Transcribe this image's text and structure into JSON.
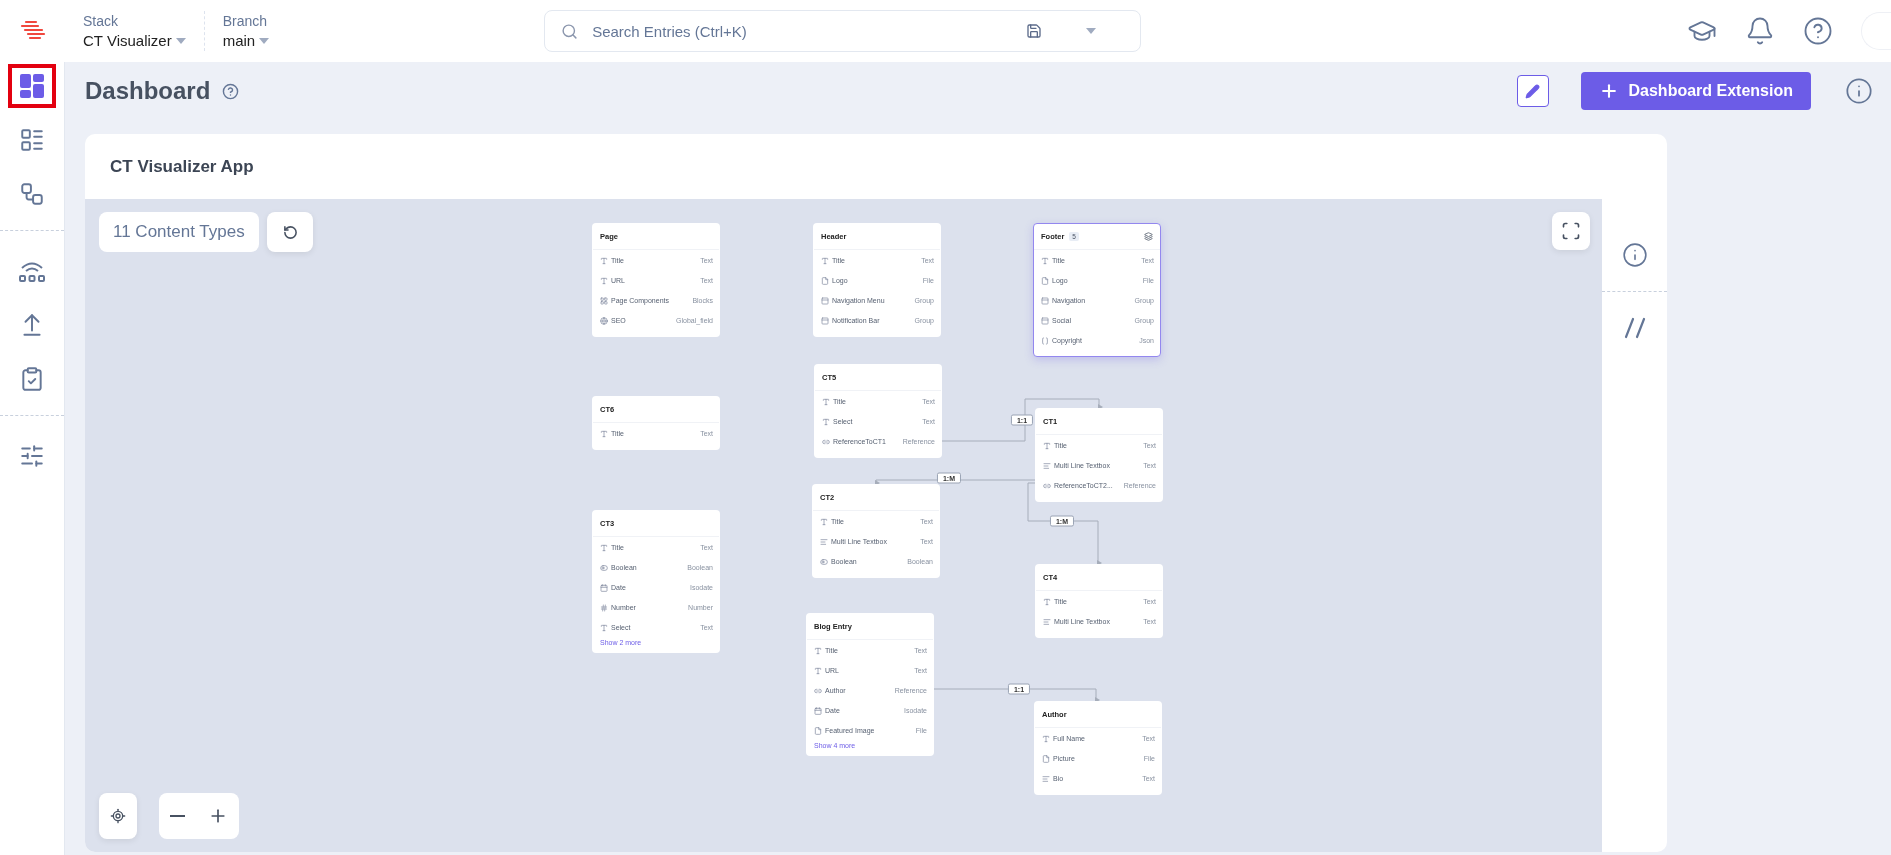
{
  "topbar": {
    "stack_label": "Stack",
    "stack": "CT Visualizer",
    "branch_label": "Branch",
    "branch": "main",
    "search": {
      "placeholder": "Search Entries (Ctrl+K)"
    }
  },
  "sidebar": {
    "groups": [
      [
        {
          "kind": "dashboard",
          "selected": true,
          "outlined": true
        },
        {
          "kind": "entries",
          "selected": false,
          "outlined": false
        },
        {
          "kind": "models",
          "selected": false,
          "outlined": false
        }
      ],
      [
        {
          "kind": "releases",
          "selected": false,
          "outlined": false
        },
        {
          "kind": "publish",
          "selected": false,
          "outlined": false
        },
        {
          "kind": "tasks",
          "selected": false,
          "outlined": false
        }
      ],
      [
        {
          "kind": "settings",
          "selected": false,
          "outlined": false
        }
      ]
    ]
  },
  "page": {
    "title": "Dashboard",
    "action": "Dashboard Extension"
  },
  "card": {
    "title": "CT Visualizer App",
    "count": "11 Content Types",
    "nodes": [
      {
        "title": "Page",
        "selected": false,
        "fields": [
          {
            "kind": "text",
            "name": "Title",
            "type": "Text"
          },
          {
            "kind": "text",
            "name": "URL",
            "type": "Text"
          },
          {
            "kind": "blocks",
            "name": "Page Components",
            "type": "Blocks"
          },
          {
            "kind": "global",
            "name": "SEO",
            "type": "Global_field"
          }
        ]
      },
      {
        "title": "Header",
        "selected": false,
        "fields": [
          {
            "kind": "text",
            "name": "Title",
            "type": "Text"
          },
          {
            "kind": "file",
            "name": "Logo",
            "type": "File"
          },
          {
            "kind": "group",
            "name": "Navigation Menu",
            "type": "Group"
          },
          {
            "kind": "group",
            "name": "Notification Bar",
            "type": "Group"
          }
        ]
      },
      {
        "title": "Footer",
        "badge": "5",
        "selected": true,
        "fields": [
          {
            "kind": "text",
            "name": "Title",
            "type": "Text"
          },
          {
            "kind": "file",
            "name": "Logo",
            "type": "File"
          },
          {
            "kind": "group",
            "name": "Navigation",
            "type": "Group"
          },
          {
            "kind": "group",
            "name": "Social",
            "type": "Group"
          },
          {
            "kind": "json",
            "name": "Copyright",
            "type": "Json"
          }
        ]
      },
      {
        "title": "CT5",
        "selected": false,
        "fields": [
          {
            "kind": "text",
            "name": "Title",
            "type": "Text"
          },
          {
            "kind": "text",
            "name": "Select",
            "type": "Text"
          },
          {
            "kind": "reference",
            "name": "ReferenceToCT1",
            "type": "Reference"
          }
        ]
      },
      {
        "title": "CT6",
        "selected": false,
        "fields": [
          {
            "kind": "text",
            "name": "Title",
            "type": "Text"
          }
        ]
      },
      {
        "title": "CT1",
        "selected": false,
        "fields": [
          {
            "kind": "text",
            "name": "Title",
            "type": "Text"
          },
          {
            "kind": "multiline",
            "name": "Multi Line Textbox",
            "type": "Text"
          },
          {
            "kind": "reference",
            "name": "ReferenceToCT2...",
            "type": "Reference"
          }
        ]
      },
      {
        "title": "CT2",
        "selected": false,
        "fields": [
          {
            "kind": "text",
            "name": "Title",
            "type": "Text"
          },
          {
            "kind": "multiline",
            "name": "Multi Line Textbox",
            "type": "Text"
          },
          {
            "kind": "boolean",
            "name": "Boolean",
            "type": "Boolean"
          }
        ]
      },
      {
        "title": "CT3",
        "selected": false,
        "fields": [
          {
            "kind": "text",
            "name": "Title",
            "type": "Text"
          },
          {
            "kind": "boolean",
            "name": "Boolean",
            "type": "Boolean"
          },
          {
            "kind": "date",
            "name": "Date",
            "type": "Isodate"
          },
          {
            "kind": "number",
            "name": "Number",
            "type": "Number"
          },
          {
            "kind": "text",
            "name": "Select",
            "type": "Text"
          }
        ],
        "more": "Show 2 more"
      },
      {
        "title": "CT4",
        "selected": false,
        "fields": [
          {
            "kind": "text",
            "name": "Title",
            "type": "Text"
          },
          {
            "kind": "multiline",
            "name": "Multi Line Textbox",
            "type": "Text"
          }
        ]
      },
      {
        "title": "Blog Entry",
        "selected": false,
        "fields": [
          {
            "kind": "text",
            "name": "Title",
            "type": "Text"
          },
          {
            "kind": "text",
            "name": "URL",
            "type": "Text"
          },
          {
            "kind": "reference",
            "name": "Author",
            "type": "Reference"
          },
          {
            "kind": "date",
            "name": "Date",
            "type": "Isodate"
          },
          {
            "kind": "file",
            "name": "Featured Image",
            "type": "File"
          }
        ],
        "more": "Show 4 more"
      },
      {
        "title": "Author",
        "selected": false,
        "fields": [
          {
            "kind": "text",
            "name": "Full Name",
            "type": "Text"
          },
          {
            "kind": "file",
            "name": "Picture",
            "type": "File"
          },
          {
            "kind": "multiline",
            "name": "Bio",
            "type": "Text"
          }
        ]
      }
    ],
    "edges": [
      {
        "label": "1:1"
      },
      {
        "label": "1:M"
      },
      {
        "label": "1:M"
      },
      {
        "label": "1:1"
      }
    ]
  }
}
